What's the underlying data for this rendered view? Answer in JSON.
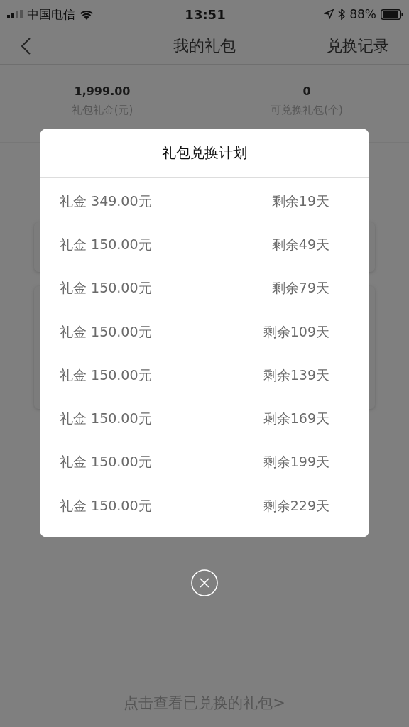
{
  "status_bar": {
    "carrier": "中国电信",
    "time": "13:51",
    "battery": "88%"
  },
  "nav": {
    "title": "我的礼包",
    "action": "兑换记录"
  },
  "stats": [
    {
      "value": "1,999.00",
      "label": "礼包礼金(元)"
    },
    {
      "value": "0",
      "label": "可兑换礼包(个)"
    }
  ],
  "modal": {
    "title": "礼包兑换计划",
    "rows": [
      {
        "amount": "礼金 349.00元",
        "remaining": "剩余19天"
      },
      {
        "amount": "礼金 150.00元",
        "remaining": "剩余49天"
      },
      {
        "amount": "礼金 150.00元",
        "remaining": "剩余79天"
      },
      {
        "amount": "礼金 150.00元",
        "remaining": "剩余109天"
      },
      {
        "amount": "礼金 150.00元",
        "remaining": "剩余139天"
      },
      {
        "amount": "礼金 150.00元",
        "remaining": "剩余169天"
      },
      {
        "amount": "礼金 150.00元",
        "remaining": "剩余199天"
      },
      {
        "amount": "礼金 150.00元",
        "remaining": "剩余229天"
      }
    ]
  },
  "footer_link": "点击查看已兑换的礼包>"
}
